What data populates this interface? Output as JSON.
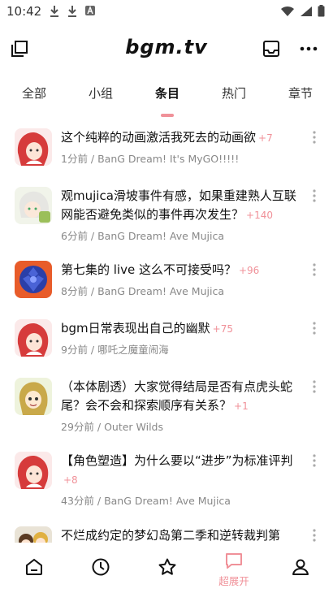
{
  "status_bar": {
    "time": "10:42",
    "icons_left": [
      "download-icon",
      "download-icon",
      "app-icon"
    ],
    "icons_right": [
      "wifi-icon",
      "signal-icon",
      "battery-icon"
    ]
  },
  "top_bar": {
    "logo": "bgm.tv",
    "icons": [
      "copy-icon",
      "inbox-icon",
      "more-horizontal-icon"
    ]
  },
  "tabs": [
    {
      "label": "全部"
    },
    {
      "label": "小组"
    },
    {
      "label": "条目",
      "active": true
    },
    {
      "label": "热门"
    },
    {
      "label": "章节"
    }
  ],
  "accent_color": "#f09199",
  "topics": [
    {
      "title": "这个纯粹的动画激活我死去的动画欲",
      "count": "+7",
      "meta": "1分前 / BanG Dream! It's MyGO!!!!!",
      "avatar": "red-hair-character"
    },
    {
      "title": "观mujica滑坡事件有感，如果重建熟人互联网能否避免类似的事件再次发生？",
      "count": "+140",
      "meta": "6分前 / BanG Dream! Ave Mujica",
      "avatar": "white-hair-character"
    },
    {
      "title": "第七集的 live 这么不可接受吗？",
      "count": "+96",
      "meta": "8分前 / BanG Dream! Ave Mujica",
      "avatar": "blue-gem-image"
    },
    {
      "title": "bgm日常表现出自己的幽默",
      "count": "+75",
      "meta": "9分前 / 哪吒之魔童闹海",
      "avatar": "red-hair-character"
    },
    {
      "title": "（本体剧透）大家觉得结局是否有点虎头蛇尾？会不会和探索顺序有关系？",
      "count": "+1",
      "meta": "29分前 / Outer Wilds",
      "avatar": "blonde-hair-character"
    },
    {
      "title": "【角色塑造】为什么要以“进步”为标准评判",
      "count": "+8",
      "meta": "43分前 / BanG Dream! Ave Mujica",
      "avatar": "red-hair-character"
    },
    {
      "title": "不烂成约定的梦幻岛第二季和逆转裁判第",
      "count": "",
      "meta": "",
      "avatar": "group-character"
    }
  ],
  "bottom_nav": [
    {
      "icon": "home-icon",
      "label": ""
    },
    {
      "icon": "clock-icon",
      "label": ""
    },
    {
      "icon": "star-icon",
      "label": ""
    },
    {
      "icon": "chat-icon",
      "label": "超展开",
      "active": true
    },
    {
      "icon": "user-icon",
      "label": ""
    }
  ]
}
